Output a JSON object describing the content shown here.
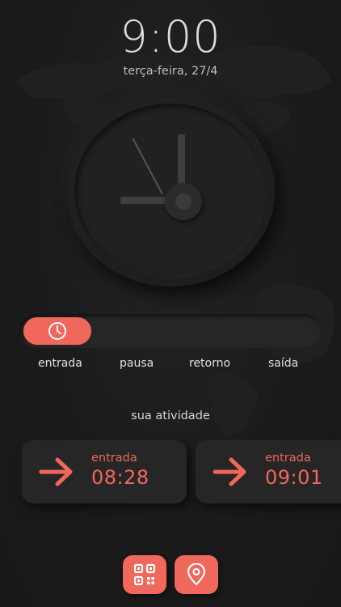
{
  "status": {
    "time": "9:00",
    "date": "terça-feira, 27/4"
  },
  "progress": {
    "current_step": 1,
    "total_steps": 4,
    "thumb_icon": "clock-icon"
  },
  "steps": [
    "entrada",
    "pausa",
    "retorno",
    "saída"
  ],
  "activity": {
    "title": "sua atividade",
    "cards": [
      {
        "label": "entrada",
        "value": "08:28",
        "icon": "arrow-right-icon"
      },
      {
        "label": "entrada",
        "value": "09:01",
        "icon": "arrow-right-icon"
      }
    ]
  },
  "actions": {
    "qr_icon": "qr-code-icon",
    "location_icon": "location-pin-icon"
  },
  "colors": {
    "accent": "#f0675c",
    "background": "#1c1c1c",
    "surface": "#262626",
    "text": "#e0e0e0"
  }
}
